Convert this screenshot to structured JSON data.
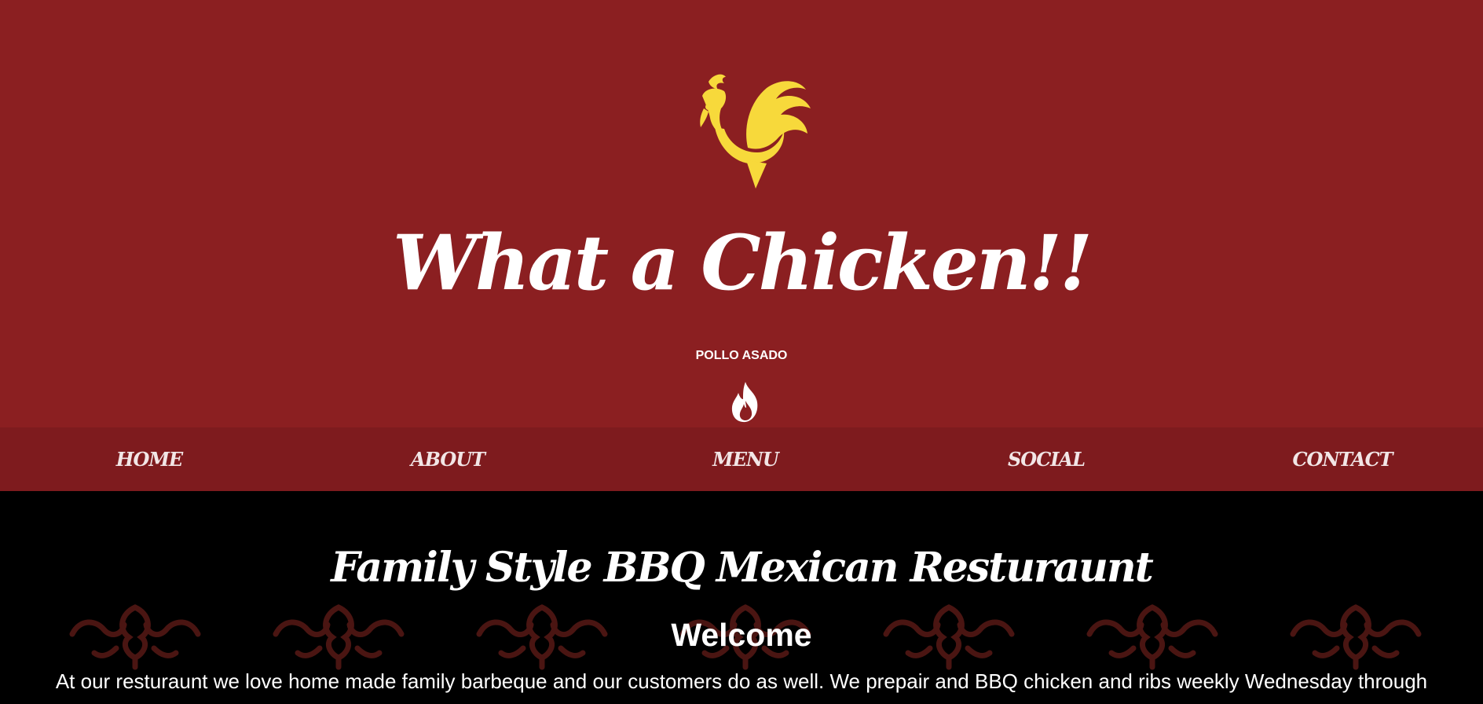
{
  "header": {
    "logo_icon": "rooster-icon",
    "title": "What a Chicken!!",
    "tagline": "POLLO ASADO",
    "flame_icon": "flame-icon",
    "background_color": "#8b1f21",
    "logo_color": "#f7d93b"
  },
  "nav": {
    "background_color": "#7e1b1e",
    "items": [
      {
        "label": "HOME"
      },
      {
        "label": "ABOUT"
      },
      {
        "label": "MENU"
      },
      {
        "label": "SOCIAL"
      },
      {
        "label": "CONTACT"
      }
    ]
  },
  "main": {
    "heading": "Family Style BBQ Mexican Resturaunt",
    "welcome": "Welcome",
    "intro": "At our resturaunt we love home made family barbeque and our customers do as well. We prepair and BBQ chicken and ribs weekly Wednesday through",
    "ornament_icon": "scroll-ornament-icon",
    "ornament_color": "#4a1512"
  }
}
